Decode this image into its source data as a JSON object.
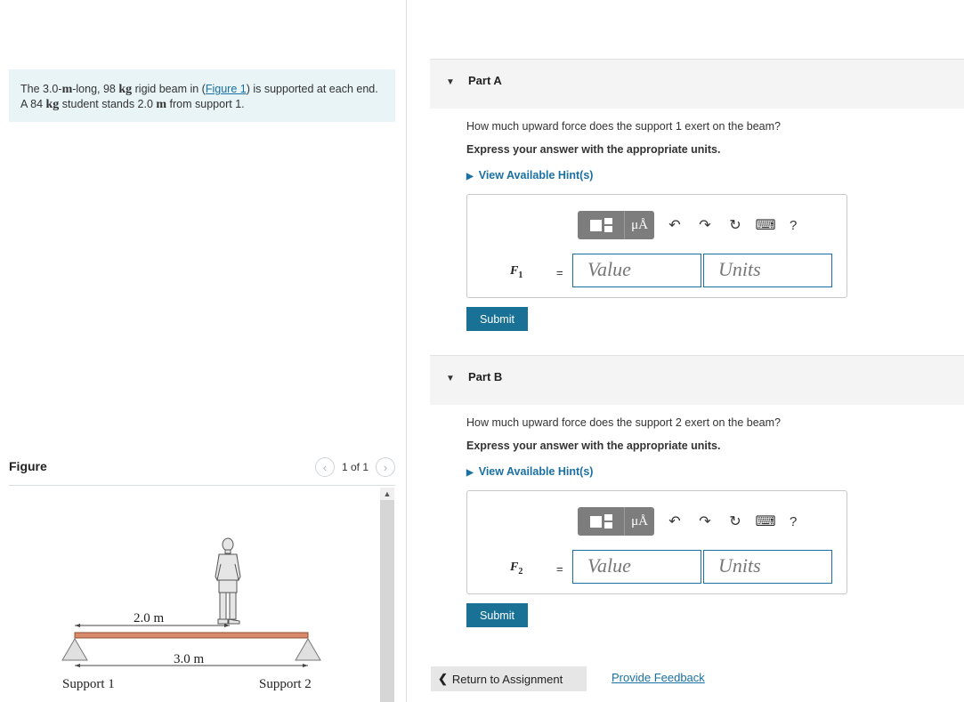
{
  "problem": {
    "segments": [
      {
        "t": "The 3.0-",
        "u": false
      },
      {
        "t": "m",
        "u": true
      },
      {
        "t": "-long, 98 ",
        "u": false
      },
      {
        "t": "kg",
        "u": true
      },
      {
        "t": " rigid beam in (",
        "u": false
      },
      {
        "t": "Figure 1",
        "link": true
      },
      {
        "t": ") is supported at each end. A 84 ",
        "u": false
      },
      {
        "t": "kg",
        "u": true
      },
      {
        "t": " student stands 2.0 ",
        "u": false
      },
      {
        "t": "m",
        "u": true
      },
      {
        "t": " from support 1.",
        "u": false
      }
    ]
  },
  "figure": {
    "title": "Figure",
    "pager_text": "1 of 1",
    "prev_icon": "chevron-left-icon",
    "next_icon": "chevron-right-icon",
    "labels": {
      "dist1": "2.0 m",
      "dist2": "3.0 m",
      "support1": "Support 1",
      "support2": "Support 2"
    },
    "colors": {
      "beam": "#d98a6a",
      "beam_edge": "#8c4f36"
    }
  },
  "parts": [
    {
      "label": "Part A",
      "question": "How much upward force does the support 1 exert on the beam?",
      "instruction": "Express your answer with the appropriate units.",
      "hint": "View Available Hint(s)",
      "variable": "F",
      "variable_sub": "1",
      "equals": "=",
      "value_placeholder": "Value",
      "units_placeholder": "Units",
      "toolbar": {
        "units_btn": "μÅ",
        "help": "?"
      },
      "submit": "Submit"
    },
    {
      "label": "Part B",
      "question": "How much upward force does the support 2 exert on the beam?",
      "instruction": "Express your answer with the appropriate units.",
      "hint": "View Available Hint(s)",
      "variable": "F",
      "variable_sub": "2",
      "equals": "=",
      "value_placeholder": "Value",
      "units_placeholder": "Units",
      "toolbar": {
        "units_btn": "μÅ",
        "help": "?"
      },
      "submit": "Submit"
    }
  ],
  "footer": {
    "return": "Return to Assignment",
    "feedback": "Provide Feedback"
  },
  "colors": {
    "accent": "#1a7196",
    "link": "#1a6fa3",
    "problem_bg": "#e8f4f6"
  }
}
